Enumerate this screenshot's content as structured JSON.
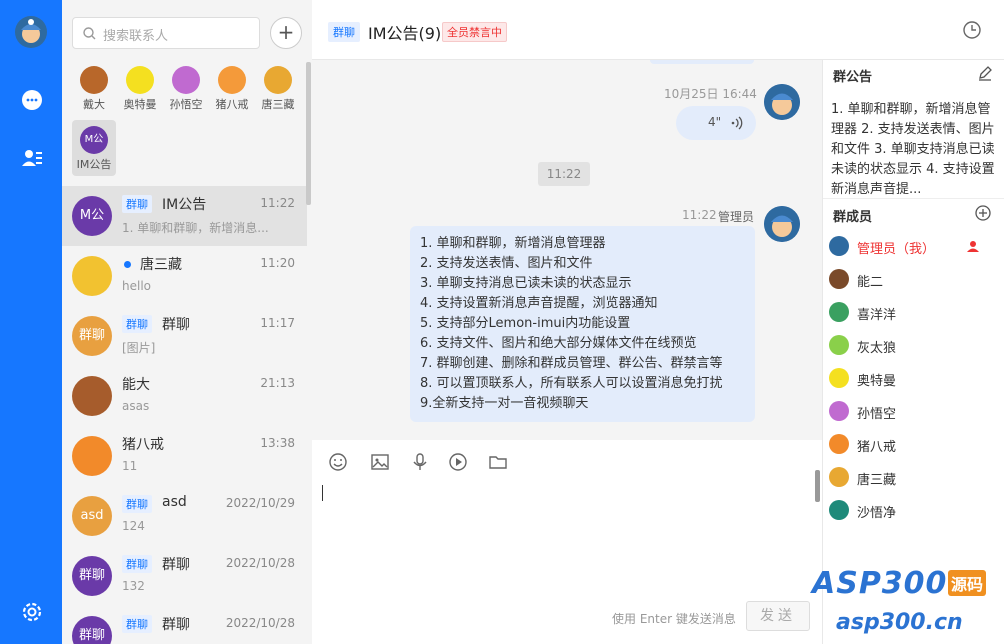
{
  "colors": {
    "accent": "#1677ff",
    "mute": "#e33333"
  },
  "search": {
    "placeholder": "搜索联系人"
  },
  "add_label": "+",
  "favorites": [
    "戴大",
    "奥特曼",
    "孙悟空",
    "猪八戒",
    "唐三藏",
    "IM公告"
  ],
  "fav_group_avatar": "M公",
  "conversations": [
    {
      "tag": "群聊",
      "name": "IM公告",
      "time": "11:22",
      "preview": "1. 单聊和群聊，新增消息...",
      "avatar": "M公"
    },
    {
      "tag": "",
      "name": "唐三藏",
      "time": "11:20",
      "preview": "hello",
      "avatar": ""
    },
    {
      "tag": "群聊",
      "name": "群聊",
      "time": "11:17",
      "preview": "[图片]",
      "avatar": "群聊"
    },
    {
      "tag": "",
      "name": "能大",
      "time": "21:13",
      "preview": "asas",
      "avatar": ""
    },
    {
      "tag": "",
      "name": "猪八戒",
      "time": "13:38",
      "preview": "11",
      "avatar": ""
    },
    {
      "tag": "群聊",
      "name": "asd",
      "time": "2022/10/29",
      "preview": "124",
      "avatar": "asd"
    },
    {
      "tag": "群聊",
      "name": "群聊",
      "time": "2022/10/28",
      "preview": "132",
      "avatar": "群聊"
    },
    {
      "tag": "群聊",
      "name": "群聊",
      "time": "2022/10/28",
      "preview": "",
      "avatar": "群聊"
    }
  ],
  "header": {
    "tag": "群聊",
    "title": "IM公告(9)",
    "mute": "全员禁言中"
  },
  "messages": {
    "voice_time": "10月25日 16:44",
    "voice_duration": "4\"",
    "time_chip": "11:22",
    "msg_time": "11:22",
    "msg_sender": "管理员",
    "lines": [
      "1. 单聊和群聊，新增消息管理器",
      "2. 支持发送表情、图片和文件",
      "3. 单聊支持消息已读未读的状态显示",
      "4. 支持设置新消息声音提醒，浏览器通知",
      "5. 支持部分Lemon-imui内功能设置",
      "6. 支持文件、图片和绝大部分媒体文件在线预览",
      "7. 群聊创建、删除和群成员管理、群公告、群禁言等",
      "8. 可以置顶联系人，所有联系人可以设置消息免打扰",
      "9.全新支持一对一音视频聊天"
    ]
  },
  "composer": {
    "hint": "使用 Enter 键发送消息",
    "send": "发送"
  },
  "sidebar": {
    "notice_title": "群公告",
    "notice": "1. 单聊和群聊，新增消息管理器 2. 支持发送表情、图片和文件 3. 单聊支持消息已读未读的状态显示 4. 支持设置新消息声音提...",
    "members_title": "群成员",
    "members": [
      "管理员（我）",
      "能二",
      "喜洋洋",
      "灰太狼",
      "奥特曼",
      "孙悟空",
      "猪八戒",
      "唐三藏",
      "沙悟净"
    ]
  },
  "watermark": {
    "brand": "ASP300",
    "badge": "源码",
    "url": "asp300.cn"
  }
}
